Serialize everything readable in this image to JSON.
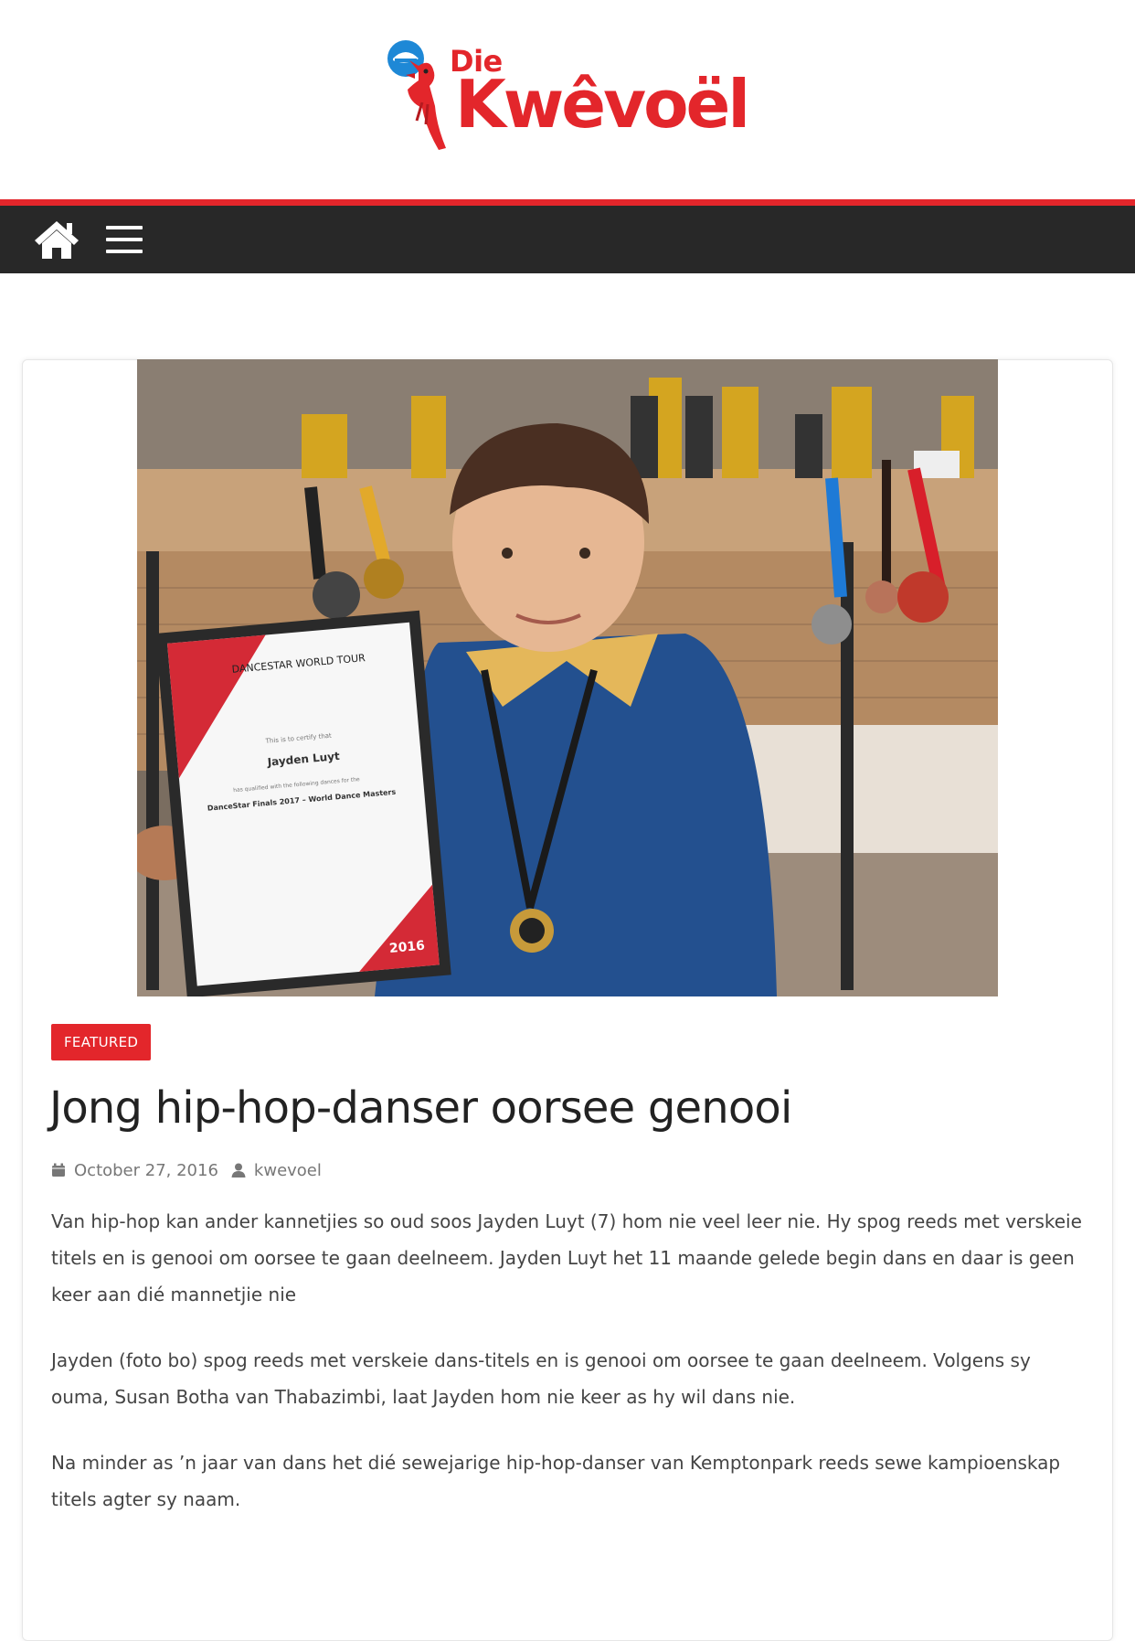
{
  "site": {
    "logo_prefix": "Die",
    "logo_name": "Kwêvoël"
  },
  "nav": {
    "home_icon": "home-icon",
    "menu_icon": "hamburger-menu-icon"
  },
  "article": {
    "category": "FEATURED",
    "title": "Jong hip-hop-danser oorsee genooi",
    "date": "October 27, 2016",
    "author": "kwevoel",
    "paragraphs": [
      "Van hip-hop kan ander kannetjies so oud soos Jayden Luyt (7) hom nie veel leer nie. Hy spog reeds met verskeie titels en is genooi om oorsee te gaan deelneem. Jayden Luyt het 11 maande gelede begin dans en daar is geen keer aan dié mannetjie nie",
      "Jayden (foto bo) spog reeds met verskeie dans-titels en is genooi om oorsee te gaan deelneem. Volgens sy ouma, Susan Botha van Thabazimbi, laat Jayden hom nie keer as hy wil dans nie.",
      "Na minder as ’n jaar van dans het dié sewejarige hip-hop-danser van Kemptonpark reeds sewe kampioenskap titels agter sy naam."
    ]
  },
  "photo": {
    "certificate_brand": "DANCESTAR WORLD TOUR",
    "certificate_line1": "This is to certify that",
    "certificate_name": "Jayden Luyt",
    "certificate_line2": "has qualified with the following dances for the",
    "certificate_event": "DanceStar Finals 2017 – World Dance Masters",
    "certificate_year": "2016"
  },
  "colors": {
    "brand_red": "#e3262b",
    "nav_bg": "#282828"
  }
}
